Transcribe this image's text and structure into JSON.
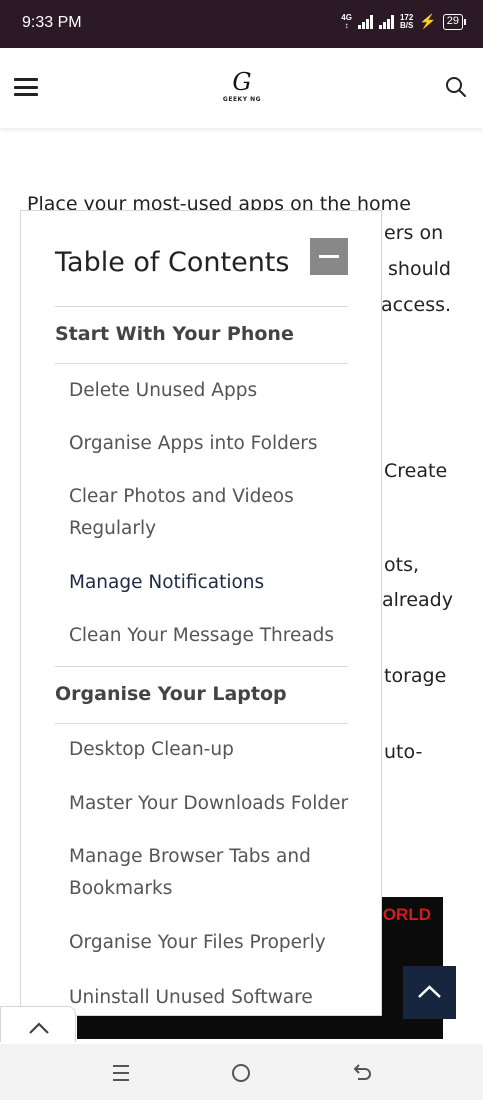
{
  "status_bar": {
    "time": "9:33 PM",
    "network": "4G",
    "speed_value": "172",
    "speed_unit": "B/S",
    "battery": "29"
  },
  "header": {
    "logo_letter": "G",
    "logo_name": "GEEKY NG"
  },
  "article": {
    "first_line": "Place your most-used apps on the home",
    "fragments": [
      "ers on",
      "should",
      "access.",
      "Create",
      "ots,",
      "already",
      "torage",
      "uto-"
    ]
  },
  "background_image": {
    "text": "ORLD"
  },
  "toc": {
    "title": "Table of Contents",
    "sections": [
      {
        "title": "Start With Your Phone",
        "items": [
          "Delete Unused Apps",
          "Organise Apps into Folders",
          "Clear Photos and Videos Regularly",
          "Manage Notifications",
          "Clean Your Message Threads"
        ]
      },
      {
        "title": "Organise Your Laptop",
        "items": [
          "Desktop Clean-up",
          "Master Your Downloads Folder",
          "Manage Browser Tabs and Bookmarks",
          "Organise Your Files Properly",
          "Uninstall Unused Software"
        ]
      }
    ],
    "active_item": "Manage Notifications"
  },
  "colors": {
    "status_bar_bg": "#2b1a25",
    "toc_toggle": "#888888",
    "back_to_top_bg": "#17263f",
    "active_link": "#1e2a44"
  },
  "icons": {
    "menu": "hamburger-icon",
    "search": "search-icon",
    "collapse": "minus-icon",
    "back_to_top": "chevron-up-icon",
    "nav_recents": "recents-icon",
    "nav_home": "home-icon",
    "nav_back": "back-icon"
  }
}
